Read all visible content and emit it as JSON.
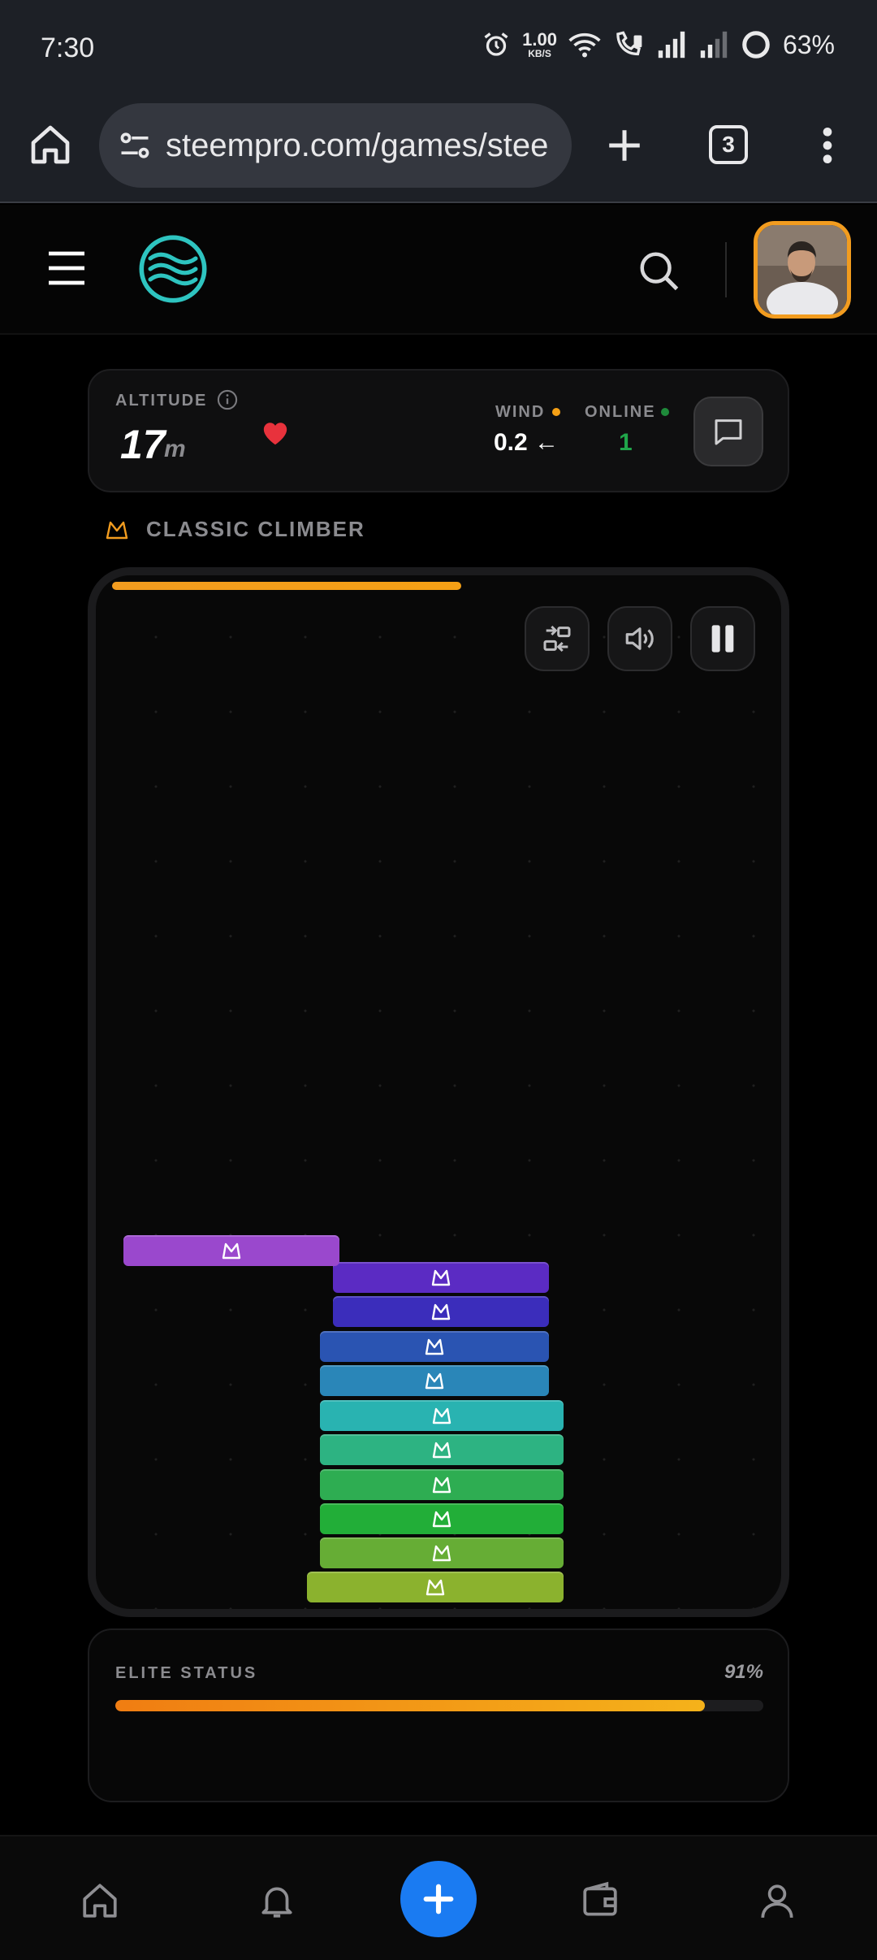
{
  "status_bar": {
    "time": "7:30",
    "net_speed_value": "1.00",
    "net_speed_unit": "KB/S",
    "battery": "63%"
  },
  "browser": {
    "url": "steempro.com/games/stee",
    "tab_count": "3"
  },
  "stats": {
    "altitude_label": "ALTITUDE",
    "altitude_value": "17",
    "altitude_unit": "m",
    "wind_label": "WIND",
    "wind_value": "0.2 ←",
    "online_label": "ONLINE",
    "online_value": "1"
  },
  "mode": {
    "label": "CLASSIC CLIMBER"
  },
  "game": {
    "top_progress_fraction": 0.51,
    "stack_block_colors": [
      "#8bb22e",
      "#66ad35",
      "#22ae38",
      "#2ead52",
      "#2db382",
      "#29b3b1",
      "#2a86b8",
      "#2a54b2",
      "#3b2dbb",
      "#5b2bc3"
    ],
    "moving_block_color": "#9a48cd"
  },
  "elite": {
    "label": "ELITE STATUS",
    "percent_text": "91%",
    "fraction": 0.91
  },
  "colors": {
    "accent_orange": "#f29c1f",
    "fab_blue": "#1a7bf2",
    "online_green": "#20a64a",
    "heart_red": "#e8323c"
  }
}
